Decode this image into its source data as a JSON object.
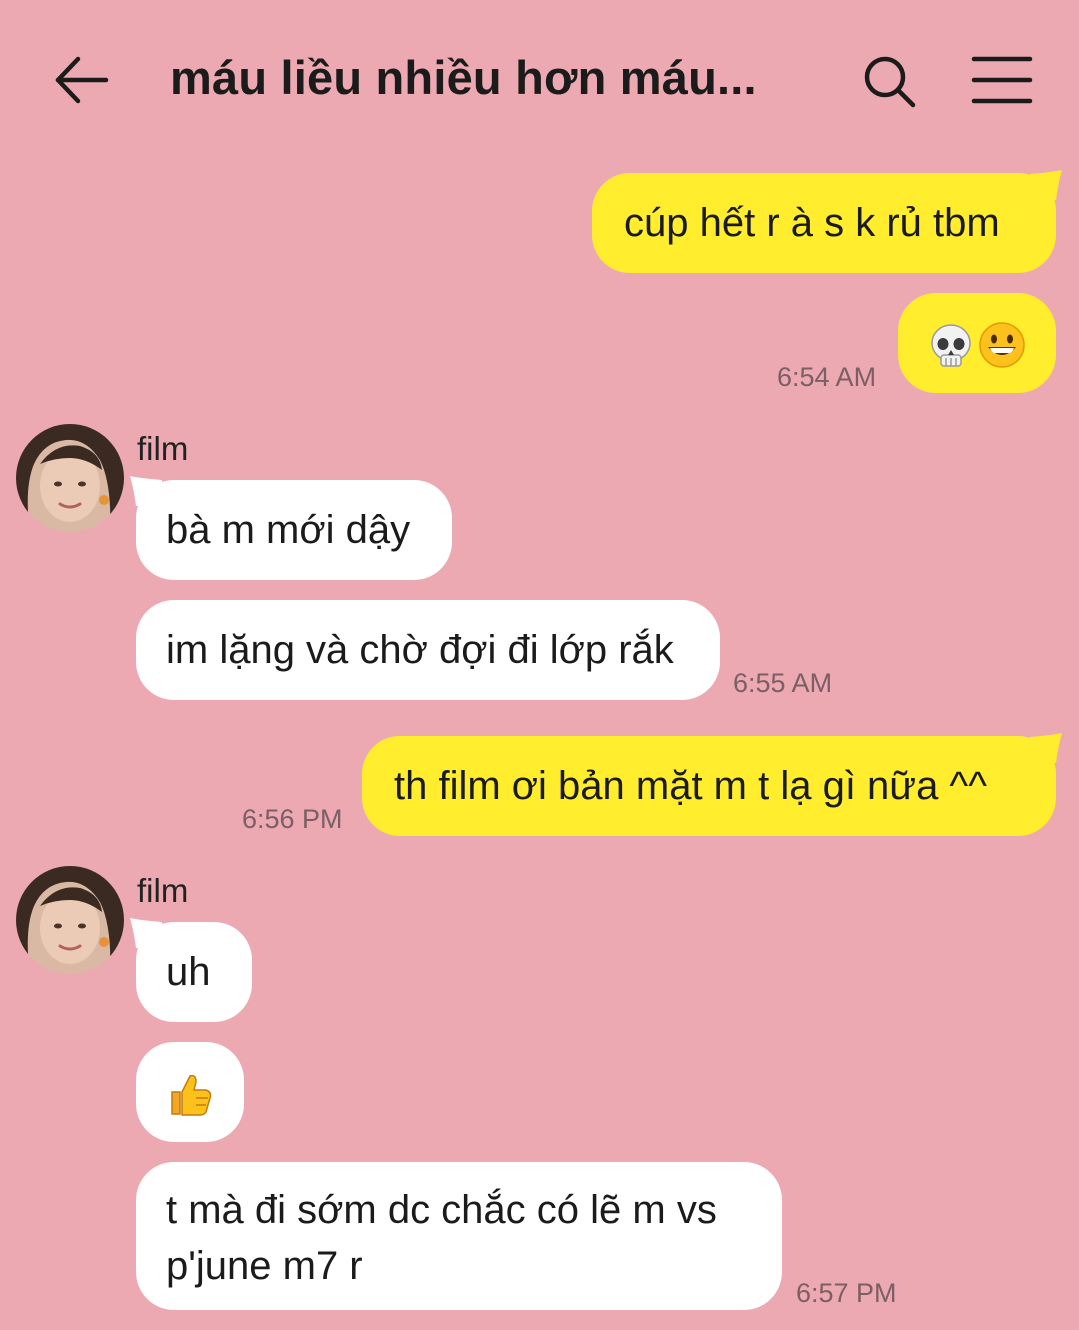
{
  "header": {
    "title": "máu liều nhiều hơn máu...",
    "back_icon": "arrow-left-icon",
    "search_icon": "search-icon",
    "menu_icon": "hamburger-menu-icon"
  },
  "colors": {
    "background": "#eca9b2",
    "my_bubble": "#ffed2e",
    "their_bubble": "#ffffff",
    "timestamp": "#7a5f64"
  },
  "messages": [
    {
      "from": "me",
      "text": "cúp hết r à s k rủ tbm"
    },
    {
      "from": "me",
      "emoji": [
        "skull-emoji",
        "grinning-face-emoji"
      ],
      "time": "6:54 AM"
    },
    {
      "from": "film",
      "sender": "film",
      "text": "bà m mới dậy"
    },
    {
      "from": "film",
      "text": "im lặng và chờ đợi đi lớp rắk",
      "time": "6:55 AM"
    },
    {
      "from": "me",
      "text": "th film ơi bản mặt m t lạ gì nữa ^^",
      "time": "6:56 PM"
    },
    {
      "from": "film",
      "sender": "film",
      "text": "uh"
    },
    {
      "from": "film",
      "emoji": [
        "thumbs-up-emoji"
      ]
    },
    {
      "from": "film",
      "text_line1": "t mà đi sớm dc chắc có lẽ m vs",
      "text_line2": "p'june m7 r",
      "time": "6:57 PM"
    }
  ]
}
